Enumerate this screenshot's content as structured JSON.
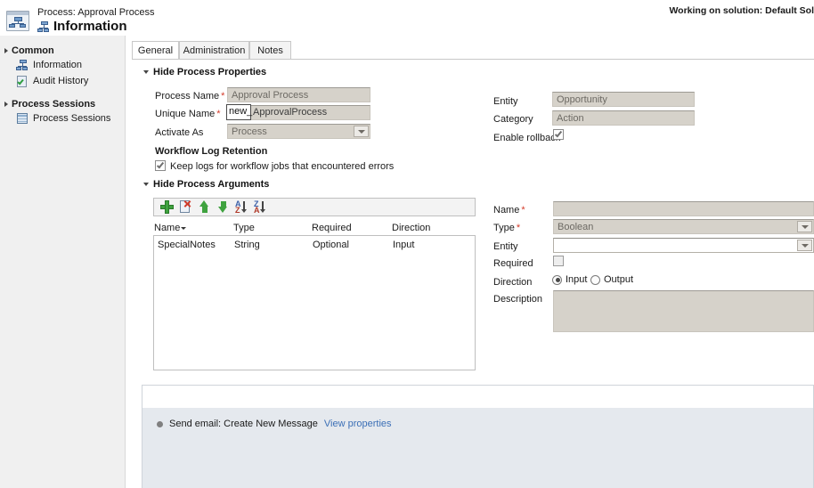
{
  "header": {
    "breadcrumb": "Process: Approval Process",
    "page_title": "Information",
    "solution_note": "Working on solution: Default Sol",
    "process_icon": "process-icon",
    "title_icon": "process-node-icon"
  },
  "sidebar": {
    "groups": [
      {
        "label": "Common",
        "items": [
          {
            "label": "Information",
            "icon": "process-node-icon"
          },
          {
            "label": "Audit History",
            "icon": "audit-page-icon"
          }
        ]
      },
      {
        "label": "Process Sessions",
        "items": [
          {
            "label": "Process Sessions",
            "icon": "sessions-grid-icon"
          }
        ]
      }
    ]
  },
  "tabs": [
    {
      "label": "General",
      "active": true
    },
    {
      "label": "Administration",
      "active": false
    },
    {
      "label": "Notes",
      "active": false
    }
  ],
  "sections": {
    "properties": {
      "toggle_label": "Hide Process Properties",
      "left_fields": {
        "process_name_label": "Process Name",
        "process_name_value": "Approval Process",
        "unique_name_label": "Unique Name",
        "unique_name_prefix": "new_",
        "unique_name_suffix": "ApprovalProcess",
        "activate_as_label": "Activate As",
        "activate_as_value": "Process"
      },
      "right_fields": {
        "entity_label": "Entity",
        "entity_value": "Opportunity",
        "category_label": "Category",
        "category_value": "Action",
        "enable_rollback_label": "Enable rollback",
        "enable_rollback_checked": true
      },
      "log_retention": {
        "heading": "Workflow Log Retention",
        "checkbox_label": "Keep logs for workflow jobs that encountered errors",
        "checked": true
      }
    },
    "arguments": {
      "toggle_label": "Hide Process Arguments",
      "toolbar": [
        {
          "name": "add-argument-button",
          "icon": "plus-icon"
        },
        {
          "name": "delete-argument-button",
          "icon": "delete-page-icon"
        },
        {
          "name": "move-up-button",
          "icon": "arrow-up-icon"
        },
        {
          "name": "move-down-button",
          "icon": "arrow-down-icon"
        },
        {
          "name": "sort-ascending-button",
          "icon": "sort-az-icon"
        },
        {
          "name": "sort-descending-button",
          "icon": "sort-za-icon"
        }
      ],
      "columns": [
        "Name",
        "Type",
        "Required",
        "Direction"
      ],
      "sorted_column": "Name",
      "rows": [
        {
          "name": "SpecialNotes",
          "type": "String",
          "required": "Optional",
          "direction": "Input"
        }
      ],
      "detail": {
        "name_label": "Name",
        "name_value": "",
        "type_label": "Type",
        "type_value": "Boolean",
        "entity_label": "Entity",
        "entity_value": "",
        "required_label": "Required",
        "required_checked": false,
        "direction_label": "Direction",
        "direction_input_label": "Input",
        "direction_output_label": "Output",
        "direction_selected": "Input",
        "description_label": "Description",
        "description_value": ""
      }
    }
  },
  "designer": {
    "steps": [
      {
        "text": "Send email: Create New Message",
        "link": "View properties"
      }
    ]
  },
  "colors": {
    "required_asterisk": "#d43b2a",
    "link": "#3b6fb6",
    "sidebar_bg": "#f0f0f0",
    "disabled_field": "#d6d2ca",
    "designer_bg": "#e5e9ee",
    "toolbar_green": "#3fa23f"
  }
}
